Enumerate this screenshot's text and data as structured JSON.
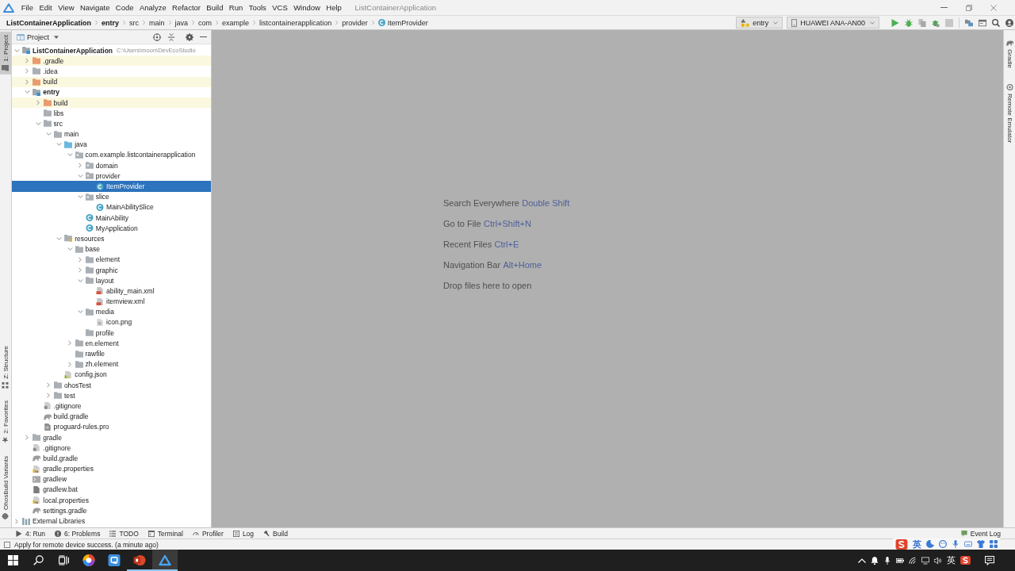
{
  "menu_bar": {
    "items": [
      "File",
      "Edit",
      "View",
      "Navigate",
      "Code",
      "Analyze",
      "Refactor",
      "Build",
      "Run",
      "Tools",
      "VCS",
      "Window",
      "Help"
    ],
    "title": "ListContainerApplication"
  },
  "breadcrumbs": [
    {
      "label": "ListContainerApplication",
      "kind": "project"
    },
    {
      "label": "entry",
      "kind": "module"
    },
    {
      "label": "src",
      "kind": "folder"
    },
    {
      "label": "main",
      "kind": "folder"
    },
    {
      "label": "java",
      "kind": "folder"
    },
    {
      "label": "com",
      "kind": "folder"
    },
    {
      "label": "example",
      "kind": "folder"
    },
    {
      "label": "listcontainerapplication",
      "kind": "folder"
    },
    {
      "label": "provider",
      "kind": "folder"
    },
    {
      "label": "ItemProvider",
      "kind": "class"
    }
  ],
  "toolbar": {
    "run_config": "entry",
    "device": "HUAWEI ANA-AN00"
  },
  "left_strip": {
    "top": [
      {
        "label": "1: Project",
        "selected": true
      }
    ],
    "bottom": [
      {
        "label": "Z: Structure",
        "selected": false
      },
      {
        "label": "2: Favorites",
        "selected": false
      },
      {
        "label": "OhosBuild Variants",
        "selected": false
      }
    ]
  },
  "project_panel": {
    "title": "Project",
    "tree": [
      {
        "label": "ListContainerApplication",
        "kind": "module",
        "path": "C:\\Users\\moon\\DevEcoStudio",
        "expanded": true,
        "selected": false,
        "children": [
          {
            "label": ".gradle",
            "kind": "excluded",
            "expanded": false,
            "selected": false
          },
          {
            "label": ".idea",
            "kind": "folder",
            "expanded": false,
            "selected": false
          },
          {
            "label": "build",
            "kind": "excluded",
            "expanded": false,
            "selected": false
          },
          {
            "label": "entry",
            "kind": "module",
            "expanded": true,
            "selected": false,
            "children": [
              {
                "label": "build",
                "kind": "excluded",
                "expanded": false,
                "selected": false
              },
              {
                "label": "libs",
                "kind": "folder",
                "selected": false
              },
              {
                "label": "src",
                "kind": "folder",
                "expanded": true,
                "selected": false,
                "children": [
                  {
                    "label": "main",
                    "kind": "folder",
                    "expanded": true,
                    "selected": false,
                    "children": [
                      {
                        "label": "java",
                        "kind": "source",
                        "expanded": true,
                        "selected": false,
                        "children": [
                          {
                            "label": "com.example.listcontainerapplication",
                            "kind": "package",
                            "expanded": true,
                            "selected": false,
                            "children": [
                              {
                                "label": "domain",
                                "kind": "package",
                                "expanded": false,
                                "selected": false
                              },
                              {
                                "label": "provider",
                                "kind": "package",
                                "expanded": true,
                                "selected": false,
                                "children": [
                                  {
                                    "label": "ItemProvider",
                                    "kind": "class",
                                    "selected": true
                                  }
                                ]
                              },
                              {
                                "label": "slice",
                                "kind": "package",
                                "expanded": true,
                                "selected": false,
                                "children": [
                                  {
                                    "label": "MainAbilitySlice",
                                    "kind": "class",
                                    "selected": false
                                  }
                                ]
                              },
                              {
                                "label": "MainAbility",
                                "kind": "class",
                                "selected": false
                              },
                              {
                                "label": "MyApplication",
                                "kind": "class",
                                "selected": false
                              }
                            ]
                          }
                        ]
                      },
                      {
                        "label": "resources",
                        "kind": "resources",
                        "expanded": true,
                        "selected": false,
                        "children": [
                          {
                            "label": "base",
                            "kind": "folder",
                            "expanded": true,
                            "selected": false,
                            "children": [
                              {
                                "label": "element",
                                "kind": "folder",
                                "expanded": false,
                                "selected": false
                              },
                              {
                                "label": "graphic",
                                "kind": "folder",
                                "expanded": false,
                                "selected": false
                              },
                              {
                                "label": "layout",
                                "kind": "folder",
                                "expanded": true,
                                "selected": false,
                                "children": [
                                  {
                                    "label": "ability_main.xml",
                                    "kind": "xml",
                                    "selected": false
                                  },
                                  {
                                    "label": "itemview.xml",
                                    "kind": "xml",
                                    "selected": false
                                  }
                                ]
                              },
                              {
                                "label": "media",
                                "kind": "folder",
                                "expanded": true,
                                "selected": false,
                                "children": [
                                  {
                                    "label": "icon.png",
                                    "kind": "image",
                                    "selected": false
                                  }
                                ]
                              },
                              {
                                "label": "profile",
                                "kind": "folder",
                                "selected": false
                              }
                            ]
                          },
                          {
                            "label": "en.element",
                            "kind": "folder",
                            "expanded": false,
                            "selected": false
                          },
                          {
                            "label": "rawfile",
                            "kind": "folder",
                            "selected": false
                          },
                          {
                            "label": "zh.element",
                            "kind": "folder",
                            "expanded": false,
                            "selected": false
                          }
                        ]
                      },
                      {
                        "label": "config.json",
                        "kind": "json",
                        "selected": false
                      }
                    ]
                  },
                  {
                    "label": "ohosTest",
                    "kind": "folder",
                    "expanded": false,
                    "selected": false
                  },
                  {
                    "label": "test",
                    "kind": "folder",
                    "expanded": false,
                    "selected": false
                  }
                ]
              },
              {
                "label": ".gitignore",
                "kind": "gitignore",
                "selected": false
              },
              {
                "label": "build.gradle",
                "kind": "gradle",
                "selected": false
              },
              {
                "label": "proguard-rules.pro",
                "kind": "text",
                "selected": false
              }
            ]
          },
          {
            "label": "gradle",
            "kind": "folder",
            "expanded": false,
            "selected": false
          },
          {
            "label": ".gitignore",
            "kind": "gitignore",
            "selected": false
          },
          {
            "label": "build.gradle",
            "kind": "gradle",
            "selected": false
          },
          {
            "label": "gradle.properties",
            "kind": "properties",
            "selected": false
          },
          {
            "label": "gradlew",
            "kind": "script",
            "selected": false
          },
          {
            "label": "gradlew.bat",
            "kind": "bat",
            "selected": false
          },
          {
            "label": "local.properties",
            "kind": "properties",
            "selected": false
          },
          {
            "label": "settings.gradle",
            "kind": "gradle",
            "selected": false
          }
        ]
      },
      {
        "label": "External Libraries",
        "kind": "library",
        "expanded": false,
        "selected": false
      }
    ]
  },
  "editor": {
    "hints": [
      {
        "text": "Search Everywhere",
        "shortcut": "Double Shift"
      },
      {
        "text": "Go to File",
        "shortcut": "Ctrl+Shift+N"
      },
      {
        "text": "Recent Files",
        "shortcut": "Ctrl+E"
      },
      {
        "text": "Navigation Bar",
        "shortcut": "Alt+Home"
      },
      {
        "text": "Drop files here to open"
      }
    ]
  },
  "right_strip": [
    {
      "label": "Gradle"
    },
    {
      "label": "Remote Emulator"
    }
  ],
  "bottom_tabs": {
    "items": [
      "4: Run",
      "6: Problems",
      "TODO",
      "Terminal",
      "Profiler",
      "Log",
      "Build"
    ],
    "event_log": "Event Log"
  },
  "status_bar": "Apply for remote device success. (a minute ago)",
  "ime_toolbar": {
    "mode": "英"
  },
  "taskbar": {
    "apps": [
      {
        "kind": "browser",
        "open": false,
        "selected": false
      },
      {
        "kind": "notes",
        "open": false,
        "selected": false
      },
      {
        "kind": "slides",
        "open": true,
        "selected": false
      },
      {
        "kind": "ide",
        "open": true,
        "selected": true
      }
    ],
    "language": "英"
  }
}
